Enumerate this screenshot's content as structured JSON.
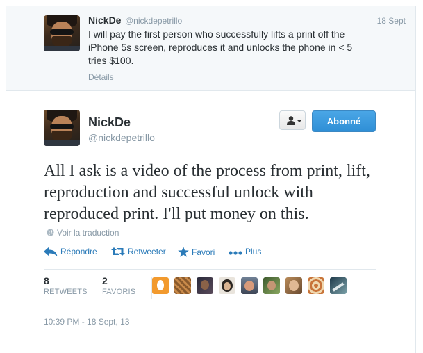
{
  "parent_tweet": {
    "name": "NickDe",
    "handle": "@nickdepetrillo",
    "date": "18 Sept",
    "text": "I will pay the first person who successfully lifts a print off the iPhone 5s screen, reproduces it and unlocks the phone in < 5 tries $100.",
    "details_link": "Détails"
  },
  "main_tweet": {
    "name": "NickDe",
    "handle": "@nickdepetrillo",
    "follow_button": "Abonné",
    "user_menu_icon": "user-dropdown-icon",
    "text": "All I ask is a video of the process from print, lift, reproduction and successful unlock with reproduced print. I'll put money on this.",
    "translate_link": "Voir la traduction",
    "actions": {
      "reply": "Répondre",
      "retweet": "Retweeter",
      "favorite": "Favori",
      "more": "Plus"
    },
    "stats": {
      "retweets_count": "8",
      "retweets_label": "RETWEETS",
      "favorites_count": "2",
      "favorites_label": "FAVORIS"
    },
    "timestamp": "10:39 PM - 18 Sept, 13"
  },
  "colors": {
    "link_blue": "#2b7bb9",
    "follow_blue": "#2f8fd6",
    "muted_text": "#8899a6",
    "parent_bg": "#f5f8fa"
  }
}
